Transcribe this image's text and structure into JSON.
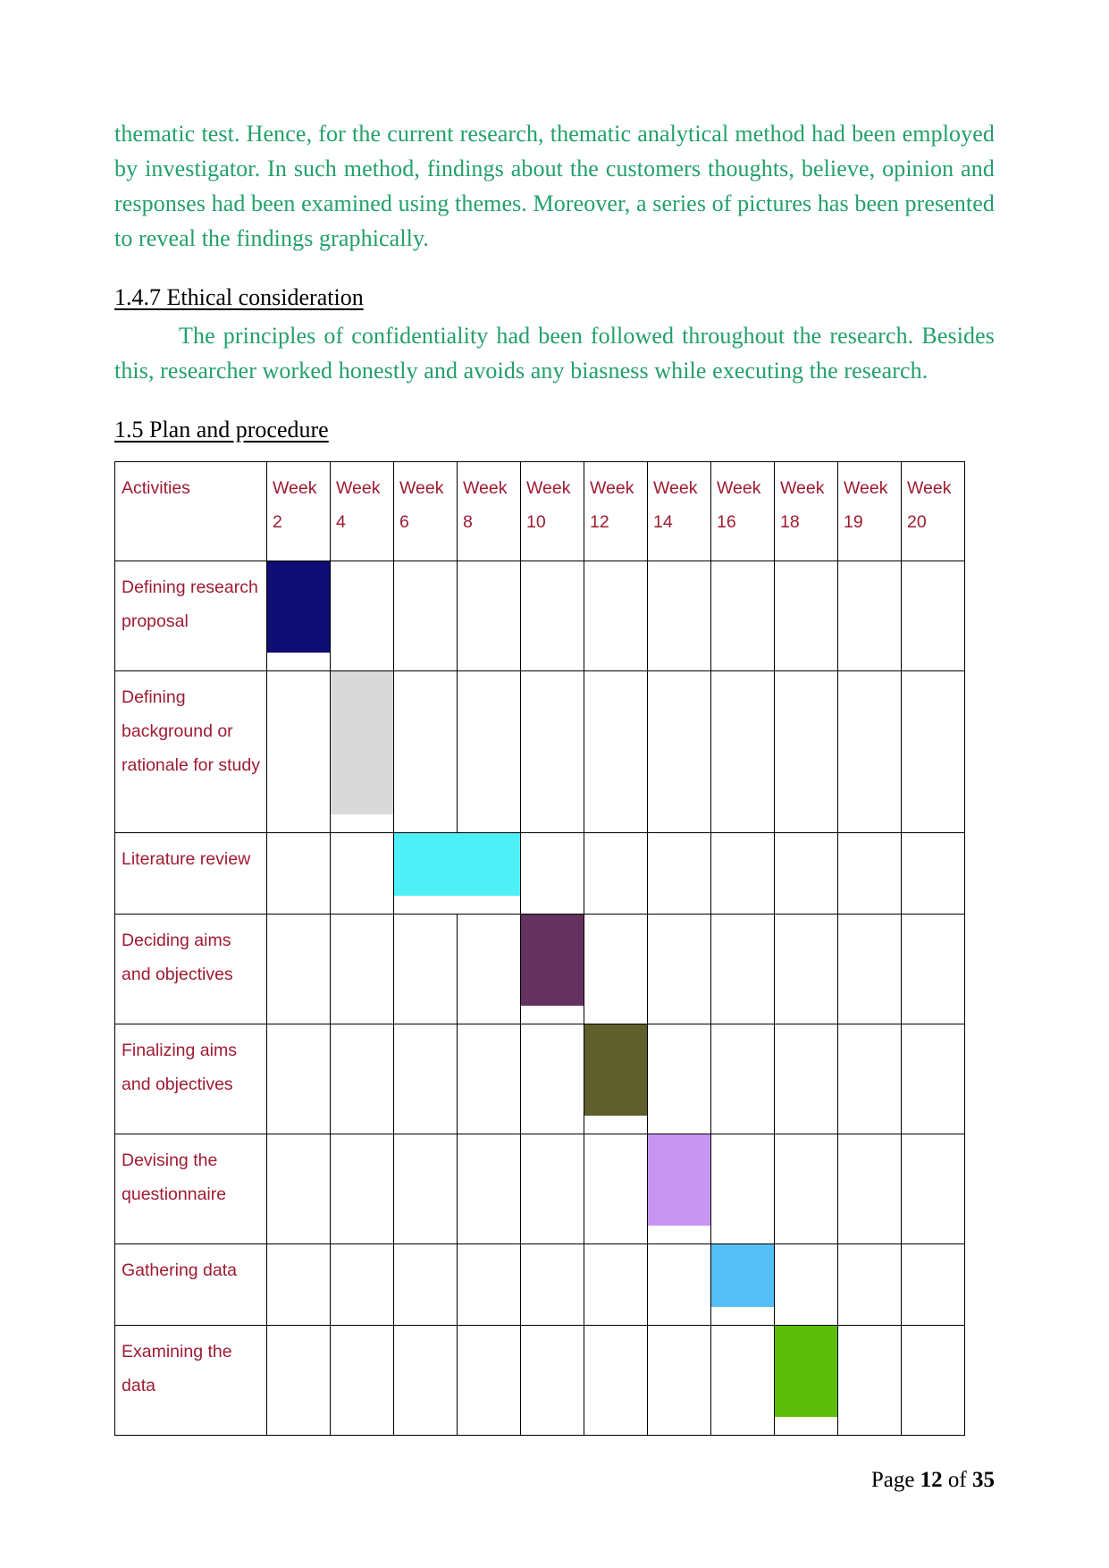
{
  "document": {
    "paragraphs": [
      "thematic test. Hence, for the current research, thematic analytical method had been employed by investigator. In such method, findings about the customers thoughts, believe, opinion and responses had been examined using themes. Moreover, a series of pictures has been presented to reveal the findings graphically."
    ],
    "section_ethical": {
      "heading": "1.4.7 Ethical consideration",
      "body": "The principles of confidentiality had been followed throughout the research. Besides this, researcher worked honestly and avoids any biasness while executing the research."
    },
    "section_plan": {
      "heading": "1.5 Plan and procedure"
    }
  },
  "gantt": {
    "columns": [
      "Activities",
      "Week 2",
      "Week 4",
      "Week 6",
      "Week 8",
      "Week 10",
      "Week 12",
      "Week 14",
      "Week 16",
      "Week 18",
      "Week 19",
      "Week 20"
    ],
    "rows": [
      {
        "activity": "Defining research proposal",
        "bars": [
          {
            "col": 1,
            "span": 1,
            "color": "#0d0d73"
          }
        ]
      },
      {
        "activity": "Defining background or rationale for study",
        "bars": [
          {
            "col": 2,
            "span": 1,
            "color": "#d9d9d9"
          }
        ]
      },
      {
        "activity": "Literature review",
        "bars": [
          {
            "col": 3,
            "span": 2,
            "color": "#4ef0f8"
          }
        ]
      },
      {
        "activity": "Deciding aims and objectives",
        "bars": [
          {
            "col": 5,
            "span": 1,
            "color": "#63325e"
          }
        ]
      },
      {
        "activity": "Finalizing aims and objectives",
        "bars": [
          {
            "col": 6,
            "span": 1,
            "color": "#5e5f2b"
          }
        ]
      },
      {
        "activity": "Devising the questionnaire",
        "bars": [
          {
            "col": 7,
            "span": 1,
            "color": "#c795f0"
          }
        ]
      },
      {
        "activity": "Gathering data",
        "bars": [
          {
            "col": 8,
            "span": 1,
            "color": "#55bff5"
          }
        ]
      },
      {
        "activity": "Examining the data",
        "bars": [
          {
            "col": 9,
            "span": 1,
            "color": "#5cbe09"
          }
        ]
      }
    ]
  },
  "footer": {
    "prefix": "Page ",
    "page_number": "12",
    "middle": " of ",
    "total_pages": "35"
  },
  "colors": {
    "body_text": "#22a06b",
    "heading_text": "#000000",
    "table_text": "#9e1b32",
    "table_border": "#000000"
  }
}
